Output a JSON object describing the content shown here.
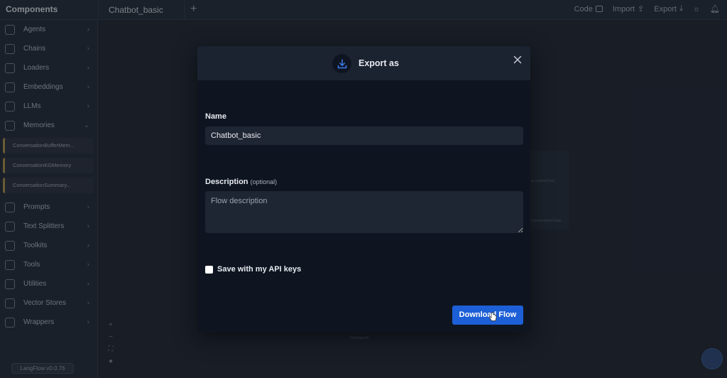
{
  "app": {
    "components_title": "Components",
    "tab_name": "Chatbot_basic",
    "add_tab": "+",
    "toolbar": {
      "code_label": "Code",
      "import_label": "Import",
      "export_label": "Export"
    },
    "version": "LangFlow v0.0.76"
  },
  "sidebar": {
    "items": [
      {
        "label": "Agents",
        "icon": "agent-icon"
      },
      {
        "label": "Chains",
        "icon": "link-icon"
      },
      {
        "label": "Loaders",
        "icon": "paperclip-icon"
      },
      {
        "label": "Embeddings",
        "icon": "embeddings-icon"
      },
      {
        "label": "LLMs",
        "icon": "lightbulb-icon"
      },
      {
        "label": "Memories",
        "icon": "memory-icon"
      },
      {
        "label": "Prompts",
        "icon": "terminal-icon"
      },
      {
        "label": "Text Splitters",
        "icon": "scissors-icon"
      },
      {
        "label": "Toolkits",
        "icon": "toolkit-icon"
      },
      {
        "label": "Tools",
        "icon": "wrench-icon"
      },
      {
        "label": "Utilities",
        "icon": "utilities-icon"
      },
      {
        "label": "Vector Stores",
        "icon": "database-icon"
      },
      {
        "label": "Wrappers",
        "icon": "gift-icon"
      }
    ],
    "memory_subitems": [
      "ConversationBufferMem...",
      "ConversationKGMemory",
      "ConversationSummary..."
    ]
  },
  "canvas": {
    "ghost_node_label": "ConversationChain",
    "ghost_node_hint": "at context from",
    "ghost_bottom_label": "ChatOpenAI"
  },
  "modal": {
    "title": "Export as",
    "name_label": "Name",
    "name_value": "Chatbot_basic",
    "description_label": "Description",
    "description_optional": "(optional)",
    "description_placeholder": "Flow description",
    "save_keys_label": "Save with my API keys",
    "download_label": "Download Flow"
  },
  "colors": {
    "accent": "#1d5fd6",
    "modal_bg": "#0f1520",
    "modal_header": "#1c2330"
  }
}
